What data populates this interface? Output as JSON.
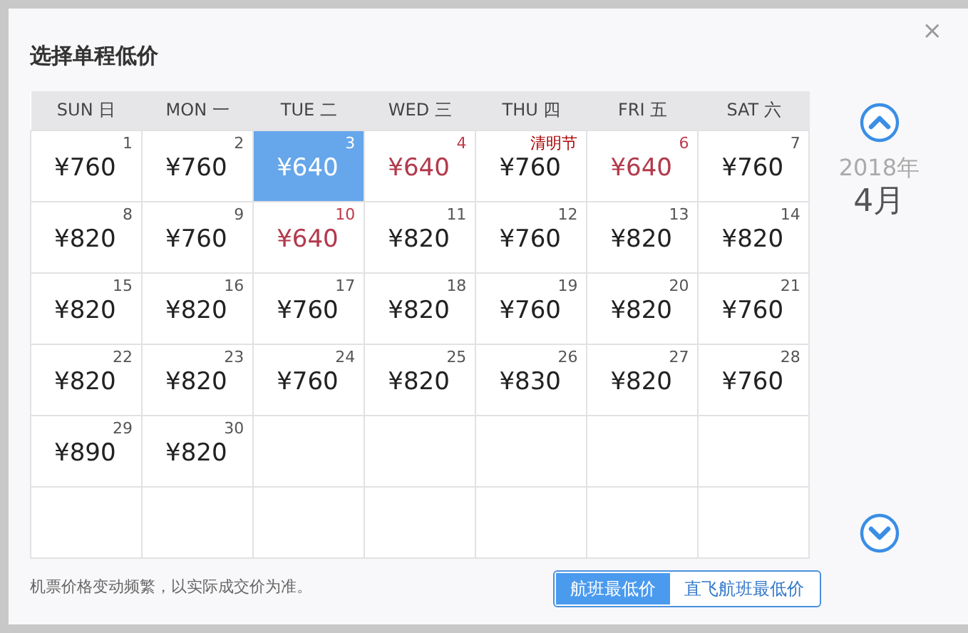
{
  "dialog": {
    "title": "选择单程低价",
    "close": "×"
  },
  "calendar": {
    "weekdays": [
      "SUN 日",
      "MON 一",
      "TUE 二",
      "WED 三",
      "THU 四",
      "FRI 五",
      "SAT 六"
    ],
    "weeks": [
      [
        {
          "kind": "date",
          "day": "1",
          "price": "¥760",
          "low": false,
          "selected": false
        },
        {
          "kind": "date",
          "day": "2",
          "price": "¥760",
          "low": false,
          "selected": false
        },
        {
          "kind": "date",
          "day": "3",
          "price": "¥640",
          "low": true,
          "selected": true
        },
        {
          "kind": "date",
          "day": "4",
          "price": "¥640",
          "low": true,
          "selected": false
        },
        {
          "kind": "holiday",
          "day": "清明节",
          "price": "¥760",
          "low": false,
          "selected": false
        },
        {
          "kind": "date",
          "day": "6",
          "price": "¥640",
          "low": true,
          "selected": false
        },
        {
          "kind": "date",
          "day": "7",
          "price": "¥760",
          "low": false,
          "selected": false
        }
      ],
      [
        {
          "kind": "date",
          "day": "8",
          "price": "¥820",
          "low": false,
          "selected": false
        },
        {
          "kind": "date",
          "day": "9",
          "price": "¥760",
          "low": false,
          "selected": false
        },
        {
          "kind": "date",
          "day": "10",
          "price": "¥640",
          "low": true,
          "selected": false
        },
        {
          "kind": "date",
          "day": "11",
          "price": "¥820",
          "low": false,
          "selected": false
        },
        {
          "kind": "date",
          "day": "12",
          "price": "¥760",
          "low": false,
          "selected": false
        },
        {
          "kind": "date",
          "day": "13",
          "price": "¥820",
          "low": false,
          "selected": false
        },
        {
          "kind": "date",
          "day": "14",
          "price": "¥820",
          "low": false,
          "selected": false
        }
      ],
      [
        {
          "kind": "date",
          "day": "15",
          "price": "¥820",
          "low": false,
          "selected": false
        },
        {
          "kind": "date",
          "day": "16",
          "price": "¥820",
          "low": false,
          "selected": false
        },
        {
          "kind": "date",
          "day": "17",
          "price": "¥760",
          "low": false,
          "selected": false
        },
        {
          "kind": "date",
          "day": "18",
          "price": "¥820",
          "low": false,
          "selected": false
        },
        {
          "kind": "date",
          "day": "19",
          "price": "¥760",
          "low": false,
          "selected": false
        },
        {
          "kind": "date",
          "day": "20",
          "price": "¥820",
          "low": false,
          "selected": false
        },
        {
          "kind": "date",
          "day": "21",
          "price": "¥760",
          "low": false,
          "selected": false
        }
      ],
      [
        {
          "kind": "date",
          "day": "22",
          "price": "¥820",
          "low": false,
          "selected": false
        },
        {
          "kind": "date",
          "day": "23",
          "price": "¥820",
          "low": false,
          "selected": false
        },
        {
          "kind": "date",
          "day": "24",
          "price": "¥760",
          "low": false,
          "selected": false
        },
        {
          "kind": "date",
          "day": "25",
          "price": "¥820",
          "low": false,
          "selected": false
        },
        {
          "kind": "date",
          "day": "26",
          "price": "¥830",
          "low": false,
          "selected": false
        },
        {
          "kind": "date",
          "day": "27",
          "price": "¥820",
          "low": false,
          "selected": false
        },
        {
          "kind": "date",
          "day": "28",
          "price": "¥760",
          "low": false,
          "selected": false
        }
      ],
      [
        {
          "kind": "date",
          "day": "29",
          "price": "¥890",
          "low": false,
          "selected": false
        },
        {
          "kind": "date",
          "day": "30",
          "price": "¥820",
          "low": false,
          "selected": false
        },
        {
          "kind": "empty"
        },
        {
          "kind": "empty"
        },
        {
          "kind": "empty"
        },
        {
          "kind": "empty"
        },
        {
          "kind": "empty"
        }
      ],
      [
        {
          "kind": "empty"
        },
        {
          "kind": "empty"
        },
        {
          "kind": "empty"
        },
        {
          "kind": "empty"
        },
        {
          "kind": "empty"
        },
        {
          "kind": "empty"
        },
        {
          "kind": "empty"
        }
      ]
    ]
  },
  "month_nav": {
    "year": "2018年",
    "month": "4月"
  },
  "footer": {
    "note": "机票价格变动频繁，以实际成交价为准。",
    "toggle": [
      {
        "label": "航班最低价",
        "selected": true
      },
      {
        "label": "直飞航班最低价",
        "selected": false
      }
    ]
  }
}
